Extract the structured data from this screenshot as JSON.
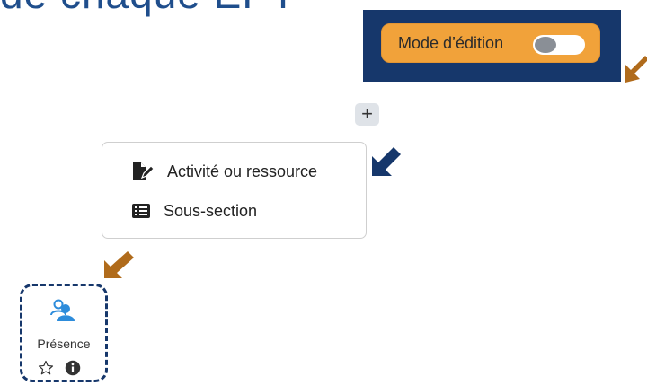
{
  "heading": {
    "text": "de chaque EPT"
  },
  "edit_mode": {
    "label": "Mode d’édition",
    "enabled": false
  },
  "add_button": {
    "label": "+"
  },
  "add_menu": {
    "items": [
      {
        "label": "Activité ou ressource",
        "icon": "file-edit-icon"
      },
      {
        "label": "Sous-section",
        "icon": "list-icon"
      }
    ]
  },
  "activity": {
    "name": "Présence",
    "icon": "attendance-icon",
    "actions": [
      "star-icon",
      "info-icon"
    ]
  },
  "colors": {
    "panel_bg": "#16376b",
    "toggle_button": "#f1a23a",
    "arrow_orange": "#b06b1b",
    "arrow_navy": "#16376b",
    "activity_icon": "#2d8cdb"
  }
}
